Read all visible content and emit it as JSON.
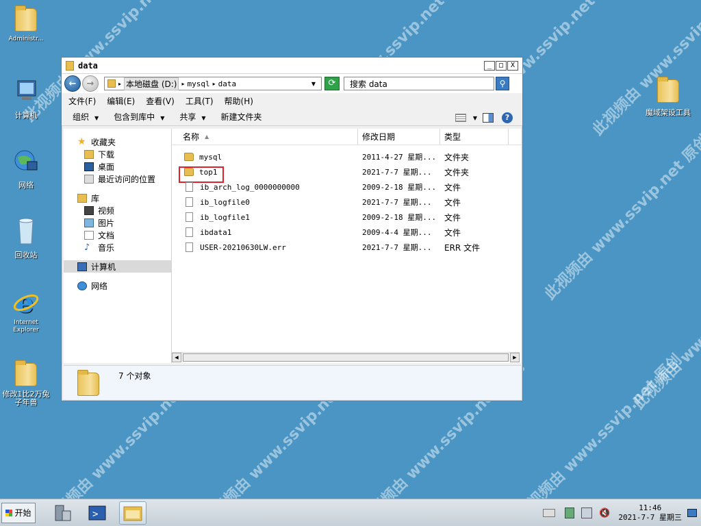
{
  "desktop": {
    "icons": [
      {
        "label": "Administr..."
      },
      {
        "label": "计算机"
      },
      {
        "label": "网络"
      },
      {
        "label": "回收站"
      },
      {
        "label": "Internet Explorer"
      },
      {
        "label": "修改1比2万兔子年兽"
      },
      {
        "label": "魔域架设工具"
      }
    ],
    "watermark": "此视频由 www.ssvip.net 原创"
  },
  "window": {
    "title": "data",
    "controls": {
      "minimize": "_",
      "maximize": "□",
      "close": "X"
    },
    "address": {
      "segments": [
        "本地磁盘 (D:)",
        "mysql",
        "data"
      ]
    },
    "search_placeholder": "搜索 data",
    "menu": [
      "文件(F)",
      "编辑(E)",
      "查看(V)",
      "工具(T)",
      "帮助(H)"
    ],
    "commands": [
      "组织",
      "包含到库中",
      "共享",
      "新建文件夹"
    ],
    "nav": {
      "favorites": "收藏夹",
      "favorites_items": [
        "下载",
        "桌面",
        "最近访问的位置"
      ],
      "libraries": "库",
      "libraries_items": [
        "视频",
        "图片",
        "文档",
        "音乐"
      ],
      "computer": "计算机",
      "network": "网络"
    },
    "columns": {
      "name": "名称",
      "date": "修改日期",
      "type": "类型"
    },
    "files": [
      {
        "name": "mysql",
        "date": "2011-4-27 星期...",
        "type": "文件夹",
        "kind": "folder"
      },
      {
        "name": "top1",
        "date": "2021-7-7 星期...",
        "type": "文件夹",
        "kind": "folder",
        "highlight": true
      },
      {
        "name": "ib_arch_log_0000000000",
        "date": "2009-2-18 星期...",
        "type": "文件",
        "kind": "file"
      },
      {
        "name": "ib_logfile0",
        "date": "2021-7-7 星期...",
        "type": "文件",
        "kind": "file"
      },
      {
        "name": "ib_logfile1",
        "date": "2009-2-18 星期...",
        "type": "文件",
        "kind": "file"
      },
      {
        "name": "ibdata1",
        "date": "2009-4-4 星期...",
        "type": "文件",
        "kind": "file"
      },
      {
        "name": "USER-20210630LW.err",
        "date": "2021-7-7 星期...",
        "type": "ERR 文件",
        "kind": "file"
      }
    ],
    "status": "7 个对象"
  },
  "taskbar": {
    "start": "开始",
    "time": "11:46",
    "date": "2021-7-7 星期三"
  },
  "colors": {
    "desktop": "#4a95c4",
    "highlight_box": "#e0202a"
  }
}
